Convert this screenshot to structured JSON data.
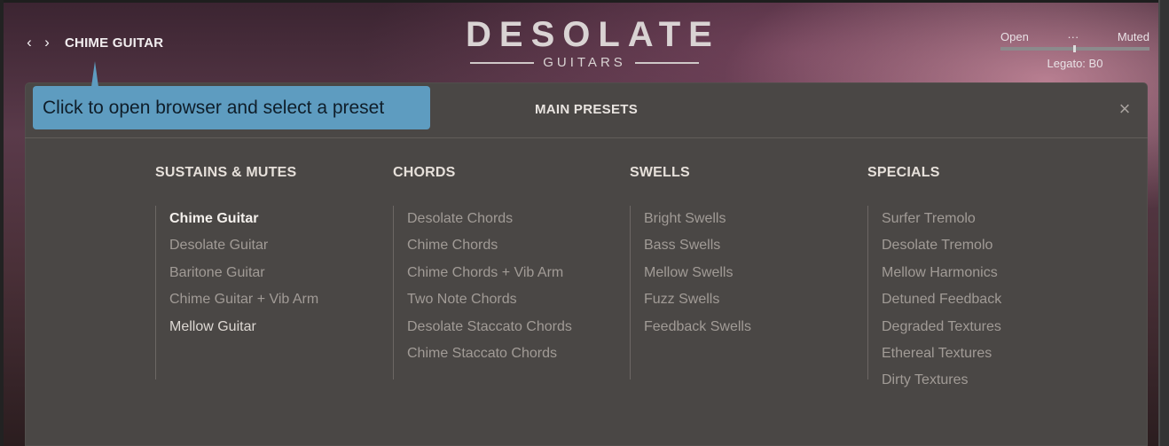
{
  "header": {
    "prev_label": "‹",
    "next_label": "›",
    "current_preset": "CHIME GUITAR",
    "logo_title": "DESOLATE",
    "logo_subtitle": "GUITARS",
    "mode_open": "Open",
    "mode_mid": "···",
    "mode_muted": "Muted",
    "legato": "Legato: B0"
  },
  "browser": {
    "title": "MAIN PRESETS",
    "close_label": "×",
    "columns": [
      {
        "title": "SUSTAINS & MUTES",
        "items": [
          "Chime Guitar",
          "Desolate Guitar",
          "Baritone Guitar",
          "Chime Guitar + Vib Arm",
          "Mellow Guitar"
        ]
      },
      {
        "title": "CHORDS",
        "items": [
          "Desolate Chords",
          "Chime Chords",
          "Chime Chords + Vib Arm",
          "Two Note Chords",
          "Desolate Staccato Chords",
          "Chime Staccato Chords"
        ]
      },
      {
        "title": "SWELLS",
        "items": [
          "Bright Swells",
          "Bass Swells",
          "Mellow Swells",
          "Fuzz Swells",
          "Feedback Swells"
        ]
      },
      {
        "title": "SPECIALS",
        "items": [
          "Surfer Tremolo",
          "Desolate Tremolo",
          "Mellow Harmonics",
          "Detuned Feedback",
          "Degraded Textures",
          "Ethereal Textures",
          "Dirty Textures"
        ]
      }
    ]
  },
  "tooltip": {
    "text": "Click to open browser and select a preset"
  },
  "colors": {
    "panel": "#4a4745",
    "tooltip": "#5e9cc0",
    "text_muted": "#a19b96"
  }
}
